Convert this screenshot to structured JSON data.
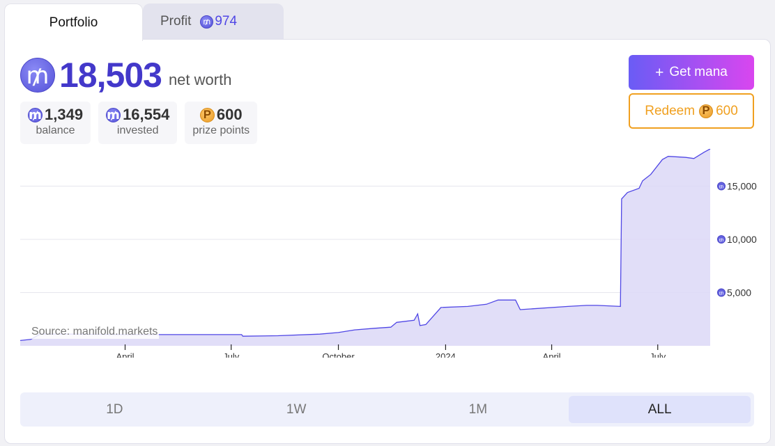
{
  "tabs": {
    "portfolio": "Portfolio",
    "profit": "Profit",
    "profit_value": "974"
  },
  "networth": {
    "value": "18,503",
    "label": "net worth"
  },
  "stats": {
    "balance": {
      "value": "1,349",
      "label": "balance"
    },
    "invested": {
      "value": "16,554",
      "label": "invested"
    },
    "prize": {
      "value": "600",
      "label": "prize points"
    }
  },
  "actions": {
    "get_mana": "Get mana",
    "get_mana_icon": "plus-icon",
    "redeem": "Redeem",
    "redeem_value": "600"
  },
  "source": "Source: manifold.markets",
  "range": {
    "options": [
      "1D",
      "1W",
      "1M",
      "ALL"
    ],
    "selected": "ALL"
  },
  "colors": {
    "accent": "#4338ca",
    "line": "#4f46e5",
    "fill": "#dcd8f7",
    "gold": "#f0a020"
  },
  "chart_data": {
    "type": "area",
    "ylim": [
      0,
      18500
    ],
    "y_ticks": [
      "5,000",
      "10,000",
      "15,000"
    ],
    "y_tick_values": [
      5000,
      10000,
      15000
    ],
    "x_tick_labels": [
      "April",
      "July",
      "October",
      "2024",
      "April",
      "July"
    ],
    "x_tick_dates": [
      "2023-04-01",
      "2023-07-01",
      "2023-10-01",
      "2024-01-01",
      "2024-04-01",
      "2024-07-01"
    ],
    "x_range": [
      "2023-01-01",
      "2024-08-15"
    ],
    "series": [
      {
        "points": [
          [
            "2023-01-01",
            500
          ],
          [
            "2023-01-10",
            600
          ],
          [
            "2023-01-18",
            1100
          ],
          [
            "2023-02-15",
            1100
          ],
          [
            "2023-04-01",
            1050
          ],
          [
            "2023-06-01",
            1050
          ],
          [
            "2023-07-10",
            1050
          ],
          [
            "2023-07-11",
            900
          ],
          [
            "2023-08-10",
            950
          ],
          [
            "2023-09-15",
            1100
          ],
          [
            "2023-10-01",
            1250
          ],
          [
            "2023-10-15",
            1500
          ],
          [
            "2023-11-01",
            1650
          ],
          [
            "2023-11-15",
            1750
          ],
          [
            "2023-11-20",
            2200
          ],
          [
            "2023-12-05",
            2400
          ],
          [
            "2023-12-08",
            3000
          ],
          [
            "2023-12-10",
            1900
          ],
          [
            "2023-12-15",
            2000
          ],
          [
            "2023-12-28",
            3600
          ],
          [
            "2024-01-20",
            3700
          ],
          [
            "2024-02-05",
            3900
          ],
          [
            "2024-02-15",
            4300
          ],
          [
            "2024-03-01",
            4300
          ],
          [
            "2024-03-05",
            3400
          ],
          [
            "2024-04-15",
            3700
          ],
          [
            "2024-05-01",
            3800
          ],
          [
            "2024-05-10",
            3800
          ],
          [
            "2024-05-30",
            3700
          ],
          [
            "2024-05-31",
            13800
          ],
          [
            "2024-06-05",
            14400
          ],
          [
            "2024-06-15",
            14800
          ],
          [
            "2024-06-18",
            15500
          ],
          [
            "2024-06-25",
            16100
          ],
          [
            "2024-07-05",
            17500
          ],
          [
            "2024-07-10",
            17800
          ],
          [
            "2024-07-25",
            17700
          ],
          [
            "2024-08-01",
            17600
          ],
          [
            "2024-08-10",
            18200
          ],
          [
            "2024-08-15",
            18503
          ]
        ]
      }
    ]
  }
}
